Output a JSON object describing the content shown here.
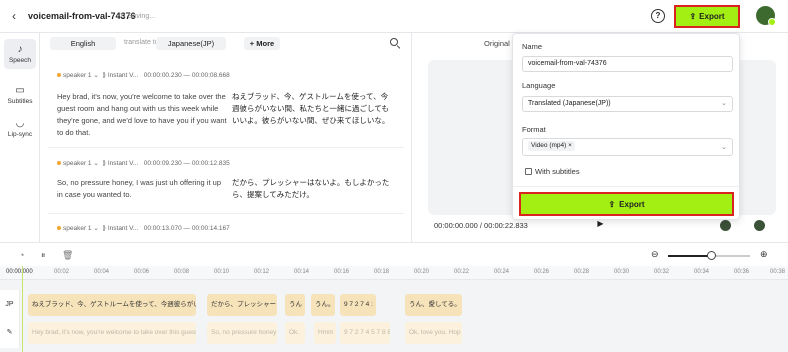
{
  "header": {
    "back_icon": "chevron-left-icon",
    "title": "voicemail-from-val-74376",
    "saving": "Saving...",
    "export_label": "Export"
  },
  "rail": [
    {
      "label": "Speech",
      "icon": "speech-icon",
      "active": true
    },
    {
      "label": "Subtitles",
      "icon": "subtitles-icon",
      "active": false
    },
    {
      "label": "Lip-sync",
      "icon": "lipsync-icon",
      "active": false
    }
  ],
  "langbar": {
    "source": "English",
    "translate_to": "translate to",
    "target": "Japanese(JP)",
    "more": "+ More"
  },
  "segments": [
    {
      "speaker": "speaker 1",
      "voice": "Instant V...",
      "start": "00:00:00.230",
      "end": "00:00:08.668",
      "source": "Hey brad, it's now, you're welcome to take over the guest room and hang out with us this week while they're gone, and we'd love to have you if you want to do that.",
      "target": "ねえブラッド、今、ゲストルームを使って、今週彼らがいない間、私たちと一緒に過ごしてもいいよ。彼らがいない間、ぜひ来てほしいな。"
    },
    {
      "speaker": "speaker 1",
      "voice": "Instant V...",
      "start": "00:00:09.230",
      "end": "00:00:12.835",
      "source": "So, no pressure honey, I was just uh offering it up in case you wanted to.",
      "target": "だから、プレッシャーはないよ。もしよかったら、提案してみただけ。"
    },
    {
      "speaker": "speaker 1",
      "voice": "Instant V...",
      "start": "00:00:13.070",
      "end": "00:00:14.167",
      "source": "",
      "target": ""
    }
  ],
  "preview": {
    "original_label": "Original V",
    "time": "00:00:00.000 / 00:00:22.833"
  },
  "dialog": {
    "name_label": "Name",
    "name_value": "voicemail-from-val-74376",
    "language_label": "Language",
    "language_value": "Translated (Japanese(JP))",
    "format_label": "Format",
    "format_value": "Video (mp4)",
    "subtitles_label": "With subtitles",
    "subtitles_checked": false,
    "export_label": "Export"
  },
  "ruler": [
    "00:00:000",
    "00:02",
    "00:04",
    "00:06",
    "00:08",
    "00:10",
    "00:12",
    "00:14",
    "00:16",
    "00:18",
    "00:20",
    "00:22",
    "00:24",
    "00:26",
    "00:28",
    "00:30",
    "00:32",
    "00:34",
    "00:36",
    "00:38"
  ],
  "tracks": {
    "jp_label": "JP",
    "en_label": "EN",
    "jp_clips": [
      "ねえブラッド、今、ゲストルームを使って、今週彼らがいない間",
      "だから、プレッシャー",
      "うん",
      "うん。",
      "9 7 2 7 4 :",
      "うん、愛してる。"
    ],
    "en_clips": [
      "Hey brad, it's now, you're welcome to take over this guest room",
      "So, no pressure honey",
      "Ok.",
      "Hmm",
      "9 7 2 7 4 5 7 8 8",
      "Ok, love you. Hop"
    ]
  },
  "colors": {
    "accent": "#a3ef14",
    "highlight": "#d9231f"
  },
  "zoom_level": 0.5
}
